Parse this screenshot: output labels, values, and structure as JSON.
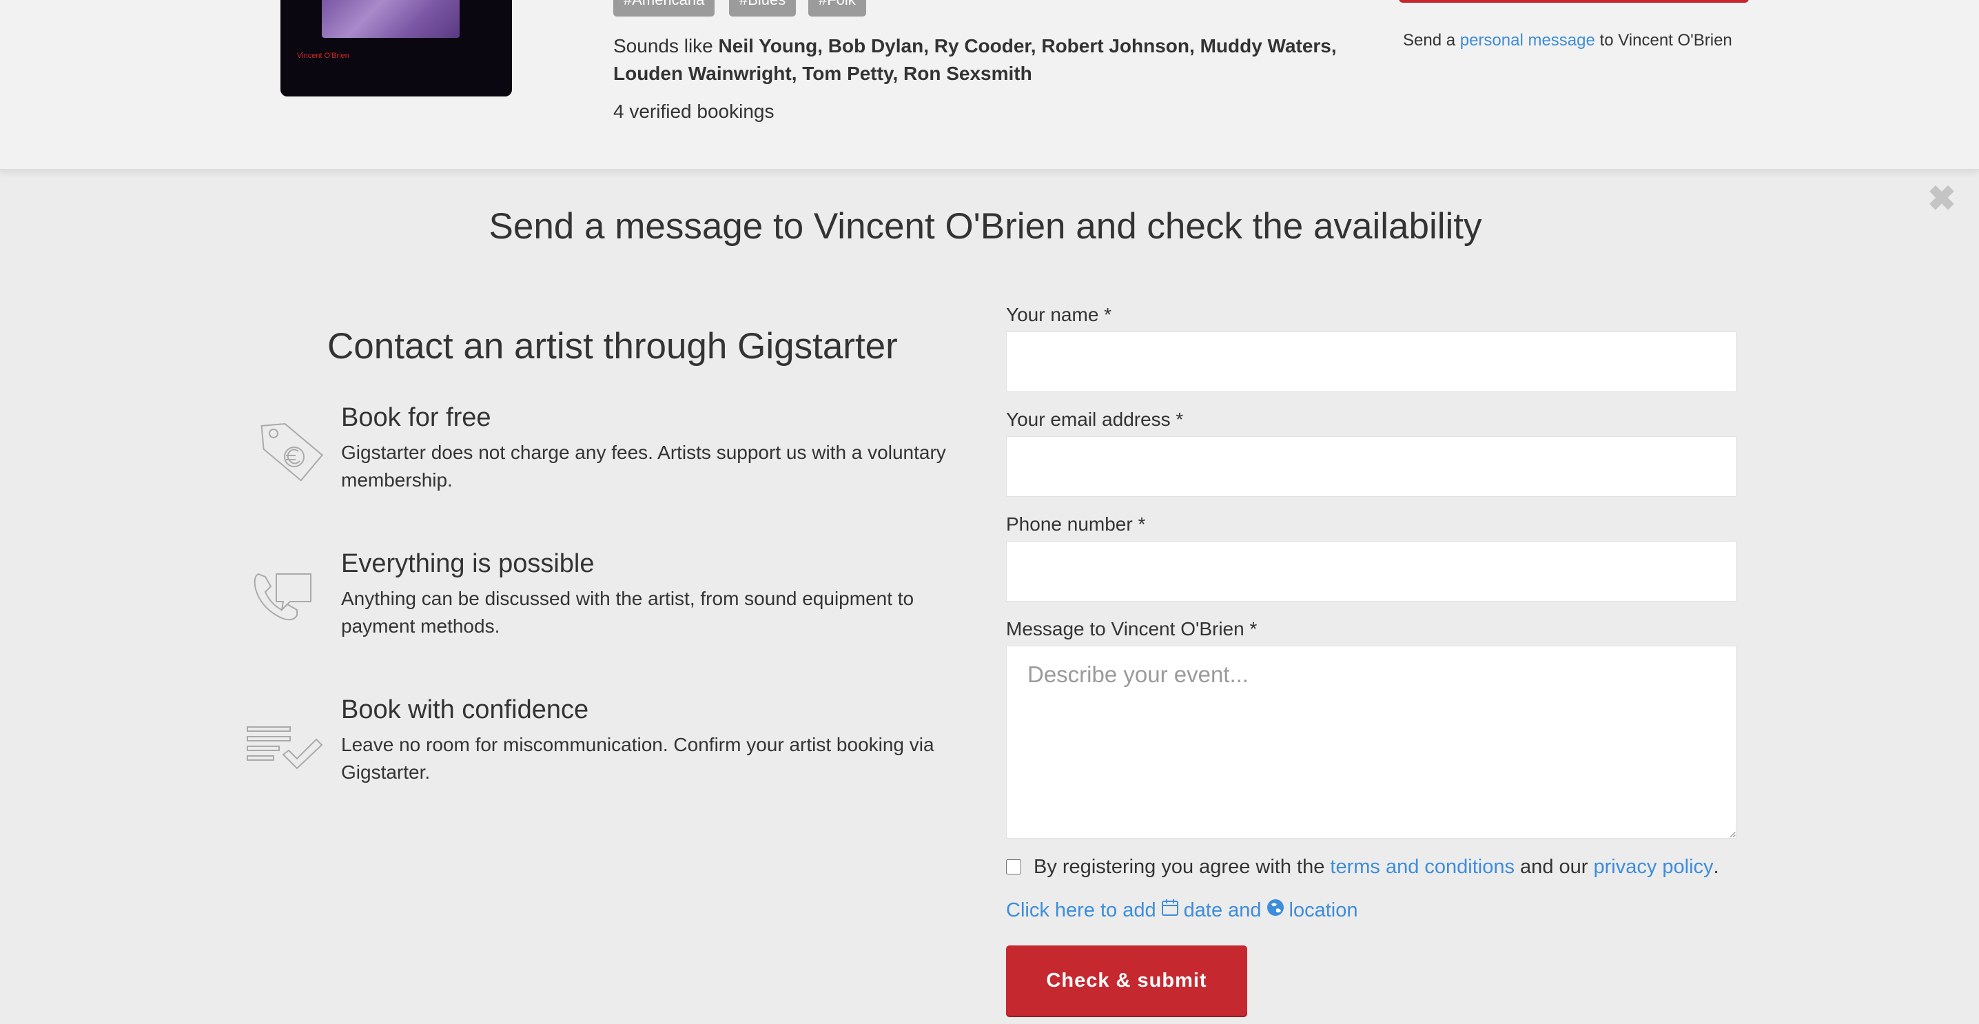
{
  "artist": {
    "album_art_label": "Vincent O'Brien",
    "tags": [
      "#Americana",
      "#Blues",
      "#Folk"
    ],
    "sounds_like_prefix": "Sounds like ",
    "sounds_like_line1": "Neil Young, Bob Dylan, Ry Cooder, Robert Johnson, Muddy Waters,",
    "sounds_like_line2": "Louden Wainwright, Tom Petty, Ron Sexsmith",
    "verified_bookings": "4 verified bookings",
    "personal_msg_prefix": "Send a ",
    "personal_msg_link": "personal message",
    "personal_msg_suffix": " to Vincent O'Brien"
  },
  "modal": {
    "close_symbol": "✖",
    "title": "Send a message to Vincent O'Brien and check the availability",
    "contact_heading": "Contact an artist through Gigstarter",
    "features": [
      {
        "title": "Book for free",
        "desc": "Gigstarter does not charge any fees. Artists support us with a voluntary membership.",
        "icon": "price-tag-icon"
      },
      {
        "title": "Everything is possible",
        "desc": "Anything can be discussed with the artist, from sound equipment to payment methods.",
        "icon": "phone-chat-icon"
      },
      {
        "title": "Book with confidence",
        "desc": "Leave no room for miscommunication. Confirm your artist booking via Gigstarter.",
        "icon": "checklist-icon"
      }
    ]
  },
  "form": {
    "name_label": "Your name *",
    "email_label": "Your email address *",
    "phone_label": "Phone number *",
    "message_label": "Message to Vincent O'Brien *",
    "message_placeholder": "Describe your event...",
    "terms_prefix": "By registering you agree with the ",
    "terms_link": "terms and conditions",
    "terms_middle": " and our ",
    "privacy_link": "privacy policy",
    "terms_suffix": ".",
    "add_prefix": "Click here to add",
    "add_date": "date and",
    "add_location": "location",
    "submit_label": "Check & submit"
  },
  "colors": {
    "accent_red": "#c5282f",
    "link_blue": "#3d8ddb",
    "tag_gray": "#9b9b9b"
  }
}
